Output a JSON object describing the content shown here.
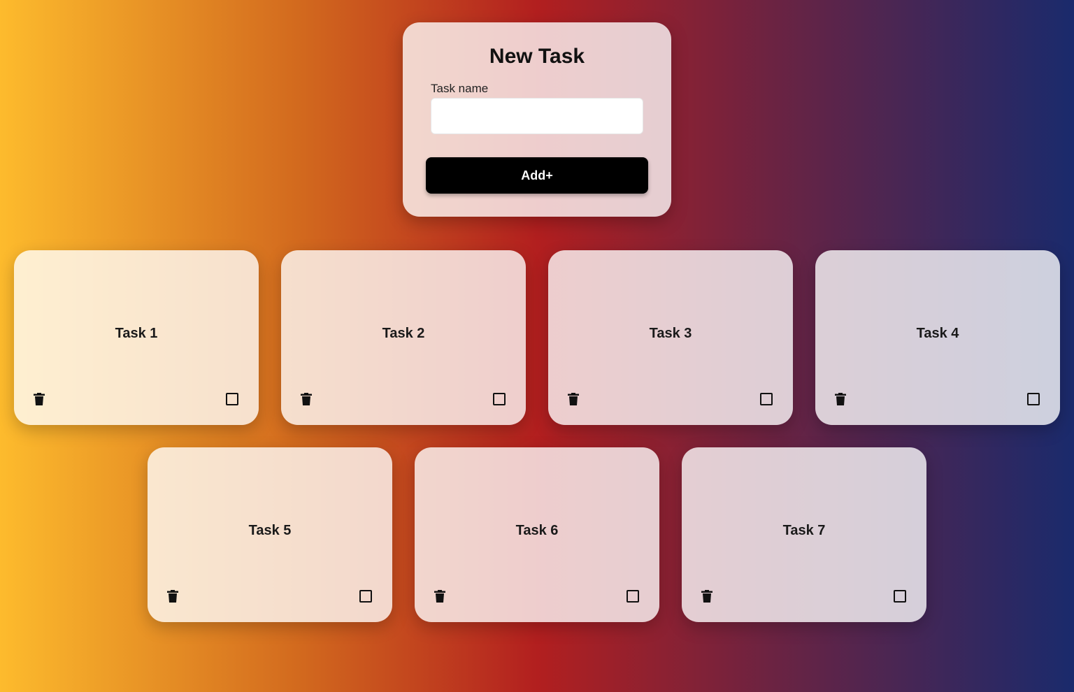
{
  "form": {
    "title": "New Task",
    "label": "Task name",
    "input_value": "",
    "input_placeholder": "",
    "button_label": "Add+"
  },
  "tasks": [
    {
      "name": "Task 1",
      "completed": false
    },
    {
      "name": "Task 2",
      "completed": false
    },
    {
      "name": "Task 3",
      "completed": false
    },
    {
      "name": "Task 4",
      "completed": false
    },
    {
      "name": "Task 5",
      "completed": false
    },
    {
      "name": "Task 6",
      "completed": false
    },
    {
      "name": "Task 7",
      "completed": false
    }
  ],
  "icons": {
    "delete": "trash-icon",
    "complete": "checkbox-icon"
  },
  "colors": {
    "gradient_start": "#fdbb2d",
    "gradient_mid": "#b21f1f",
    "gradient_end": "#1a2a6c",
    "button": "#000000"
  }
}
